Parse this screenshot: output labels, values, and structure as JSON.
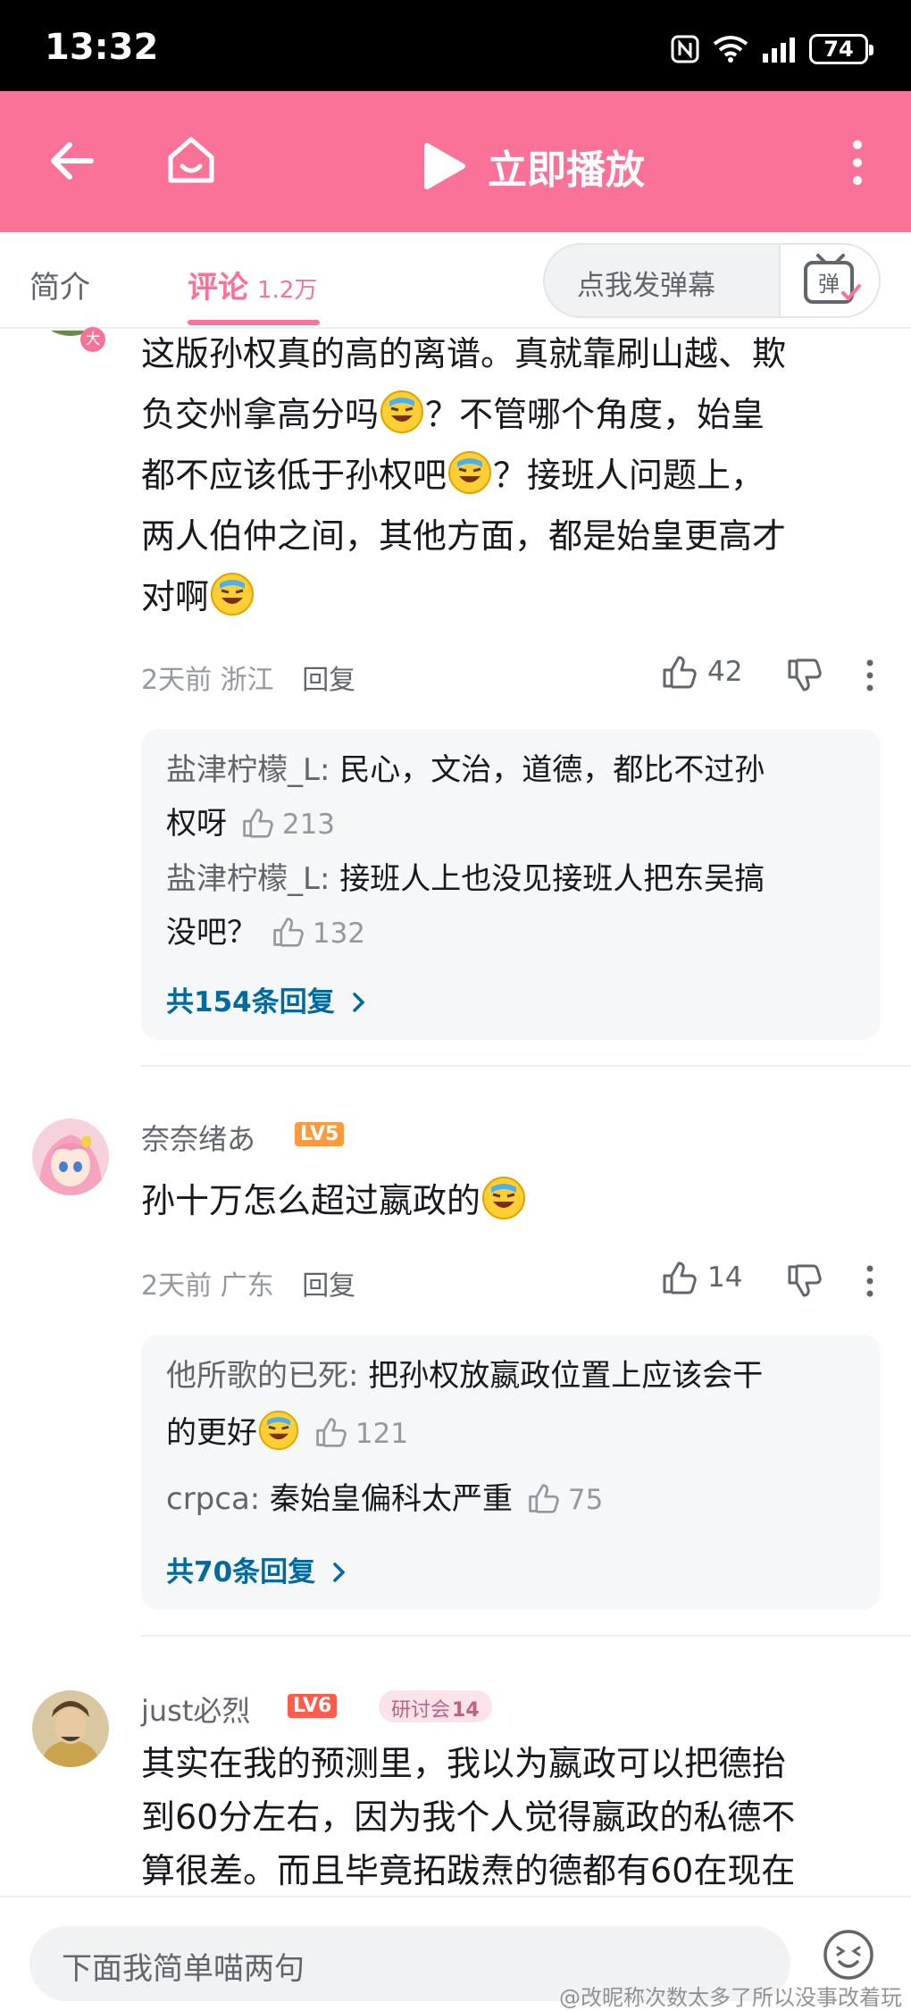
{
  "status_bar": {
    "time": "13:32",
    "battery": "74"
  },
  "header": {
    "play_label": "立即播放"
  },
  "tabs": {
    "intro": "简介",
    "comments": "评论",
    "comments_count": "1.2万",
    "danmaku_placeholder": "点我发弹幕",
    "danmaku_icon_text": "弹"
  },
  "comments": [
    {
      "badge": "大",
      "lines": [
        "这版孙权真的高的离谱。真就靠刷山越、欺",
        "负交州拿高分吗",
        "？不管哪个角度，始皇",
        "都不应该低于孙权吧",
        "？接班人问题上，",
        "两人伯仲之间，其他方面，都是始皇更高才",
        "对啊"
      ],
      "time": "2天前",
      "location": "浙江",
      "reply": "回复",
      "likes": "42",
      "replies": [
        {
          "name": "盐津柠檬_L:",
          "text": " 民心，文治，道德，都比不过孙",
          "text2": "权呀",
          "likes": "213"
        },
        {
          "name": "盐津柠檬_L:",
          "text": " 接班人上也没见接班人把东吴搞",
          "text2": "没吧？",
          "likes": "132"
        }
      ],
      "total": "共154条回复"
    },
    {
      "username": "奈奈绪あ",
      "level": "LV5",
      "text": "孙十万怎么超过嬴政的",
      "time": "2天前",
      "location": "广东",
      "reply": "回复",
      "likes": "14",
      "replies": [
        {
          "name": "他所歌的已死:",
          "text": " 把孙权放嬴政位置上应该会干",
          "text2": "的更好",
          "likes": "121"
        },
        {
          "name": "crpca:",
          "text": " 秦始皇偏科太严重",
          "likes": "75"
        }
      ],
      "total": "共70条回复"
    },
    {
      "username": "just必烈",
      "level": "LV6",
      "medal": "研讨会",
      "medal_level": "14",
      "lines": [
        "其实在我的预测里，我以为嬴政可以把德抬",
        "到60分左右，因为我个人觉得嬴政的私德不",
        "算很差。而且毕竟拓跋焘的德都有60在现在"
      ]
    }
  ],
  "bottom": {
    "input_placeholder": "下面我简单喵两句",
    "watermark": "@改昵称次数太多了所以没事改着玩"
  },
  "colors": {
    "brand_pink": "#fb7299",
    "link_blue": "#00699d",
    "lv5": "#ff9a3c",
    "lv6": "#ff5c4b"
  }
}
